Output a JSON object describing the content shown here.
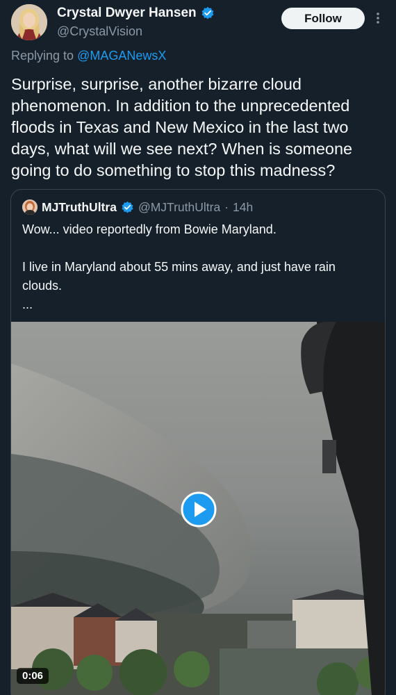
{
  "tweet": {
    "author": {
      "name": "Crystal Dwyer Hansen",
      "handle": "@CrystalVision"
    },
    "follow_label": "Follow",
    "replying_prefix": "Replying to ",
    "replying_to": "@MAGANewsX",
    "text": "Surprise, surprise, another bizarre cloud phenomenon. In addition to the unprecedented floods in Texas and New Mexico in the last two days, what will we see next? When is someone going to do something to stop this madness?"
  },
  "quoted": {
    "author": {
      "name": "MJTruthUltra",
      "handle": "@MJTruthUltra",
      "separator": "·",
      "time": "14h"
    },
    "text": "Wow... video reportedly from Bowie Maryland.\n\nI live in Maryland about 55 mins away, and just have rain clouds.\n...",
    "video": {
      "duration": "0:06"
    }
  },
  "colors": {
    "background": "#15202b",
    "accent": "#1d9bf0",
    "secondary_text": "#8b98a5",
    "border": "#38444d"
  },
  "icons": [
    "verified-badge-icon",
    "more-options-icon",
    "play-icon"
  ]
}
